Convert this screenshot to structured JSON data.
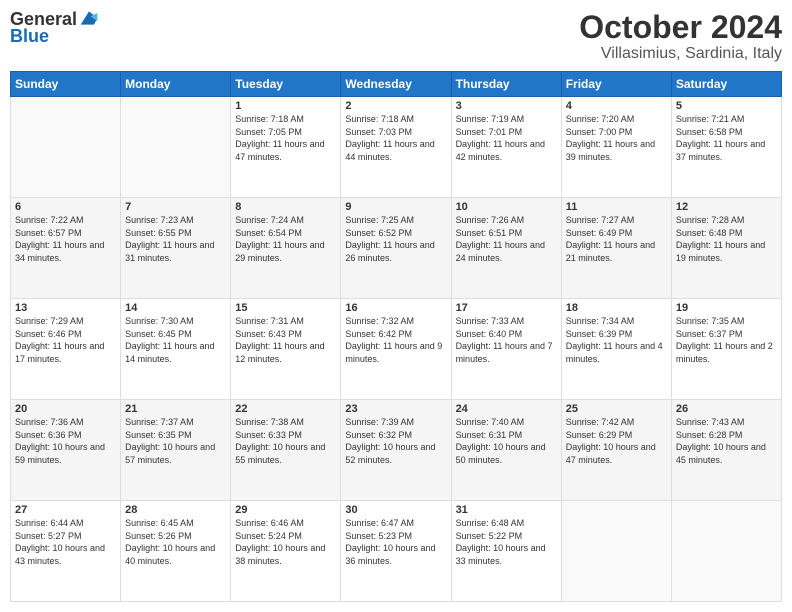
{
  "logo": {
    "line1": "General",
    "line2": "Blue"
  },
  "title": "October 2024",
  "subtitle": "Villasimius, Sardinia, Italy",
  "days_of_week": [
    "Sunday",
    "Monday",
    "Tuesday",
    "Wednesday",
    "Thursday",
    "Friday",
    "Saturday"
  ],
  "weeks": [
    [
      {
        "day": "",
        "info": ""
      },
      {
        "day": "",
        "info": ""
      },
      {
        "day": "1",
        "info": "Sunrise: 7:18 AM\nSunset: 7:05 PM\nDaylight: 11 hours and 47 minutes."
      },
      {
        "day": "2",
        "info": "Sunrise: 7:18 AM\nSunset: 7:03 PM\nDaylight: 11 hours and 44 minutes."
      },
      {
        "day": "3",
        "info": "Sunrise: 7:19 AM\nSunset: 7:01 PM\nDaylight: 11 hours and 42 minutes."
      },
      {
        "day": "4",
        "info": "Sunrise: 7:20 AM\nSunset: 7:00 PM\nDaylight: 11 hours and 39 minutes."
      },
      {
        "day": "5",
        "info": "Sunrise: 7:21 AM\nSunset: 6:58 PM\nDaylight: 11 hours and 37 minutes."
      }
    ],
    [
      {
        "day": "6",
        "info": "Sunrise: 7:22 AM\nSunset: 6:57 PM\nDaylight: 11 hours and 34 minutes."
      },
      {
        "day": "7",
        "info": "Sunrise: 7:23 AM\nSunset: 6:55 PM\nDaylight: 11 hours and 31 minutes."
      },
      {
        "day": "8",
        "info": "Sunrise: 7:24 AM\nSunset: 6:54 PM\nDaylight: 11 hours and 29 minutes."
      },
      {
        "day": "9",
        "info": "Sunrise: 7:25 AM\nSunset: 6:52 PM\nDaylight: 11 hours and 26 minutes."
      },
      {
        "day": "10",
        "info": "Sunrise: 7:26 AM\nSunset: 6:51 PM\nDaylight: 11 hours and 24 minutes."
      },
      {
        "day": "11",
        "info": "Sunrise: 7:27 AM\nSunset: 6:49 PM\nDaylight: 11 hours and 21 minutes."
      },
      {
        "day": "12",
        "info": "Sunrise: 7:28 AM\nSunset: 6:48 PM\nDaylight: 11 hours and 19 minutes."
      }
    ],
    [
      {
        "day": "13",
        "info": "Sunrise: 7:29 AM\nSunset: 6:46 PM\nDaylight: 11 hours and 17 minutes."
      },
      {
        "day": "14",
        "info": "Sunrise: 7:30 AM\nSunset: 6:45 PM\nDaylight: 11 hours and 14 minutes."
      },
      {
        "day": "15",
        "info": "Sunrise: 7:31 AM\nSunset: 6:43 PM\nDaylight: 11 hours and 12 minutes."
      },
      {
        "day": "16",
        "info": "Sunrise: 7:32 AM\nSunset: 6:42 PM\nDaylight: 11 hours and 9 minutes."
      },
      {
        "day": "17",
        "info": "Sunrise: 7:33 AM\nSunset: 6:40 PM\nDaylight: 11 hours and 7 minutes."
      },
      {
        "day": "18",
        "info": "Sunrise: 7:34 AM\nSunset: 6:39 PM\nDaylight: 11 hours and 4 minutes."
      },
      {
        "day": "19",
        "info": "Sunrise: 7:35 AM\nSunset: 6:37 PM\nDaylight: 11 hours and 2 minutes."
      }
    ],
    [
      {
        "day": "20",
        "info": "Sunrise: 7:36 AM\nSunset: 6:36 PM\nDaylight: 10 hours and 59 minutes."
      },
      {
        "day": "21",
        "info": "Sunrise: 7:37 AM\nSunset: 6:35 PM\nDaylight: 10 hours and 57 minutes."
      },
      {
        "day": "22",
        "info": "Sunrise: 7:38 AM\nSunset: 6:33 PM\nDaylight: 10 hours and 55 minutes."
      },
      {
        "day": "23",
        "info": "Sunrise: 7:39 AM\nSunset: 6:32 PM\nDaylight: 10 hours and 52 minutes."
      },
      {
        "day": "24",
        "info": "Sunrise: 7:40 AM\nSunset: 6:31 PM\nDaylight: 10 hours and 50 minutes."
      },
      {
        "day": "25",
        "info": "Sunrise: 7:42 AM\nSunset: 6:29 PM\nDaylight: 10 hours and 47 minutes."
      },
      {
        "day": "26",
        "info": "Sunrise: 7:43 AM\nSunset: 6:28 PM\nDaylight: 10 hours and 45 minutes."
      }
    ],
    [
      {
        "day": "27",
        "info": "Sunrise: 6:44 AM\nSunset: 5:27 PM\nDaylight: 10 hours and 43 minutes."
      },
      {
        "day": "28",
        "info": "Sunrise: 6:45 AM\nSunset: 5:26 PM\nDaylight: 10 hours and 40 minutes."
      },
      {
        "day": "29",
        "info": "Sunrise: 6:46 AM\nSunset: 5:24 PM\nDaylight: 10 hours and 38 minutes."
      },
      {
        "day": "30",
        "info": "Sunrise: 6:47 AM\nSunset: 5:23 PM\nDaylight: 10 hours and 36 minutes."
      },
      {
        "day": "31",
        "info": "Sunrise: 6:48 AM\nSunset: 5:22 PM\nDaylight: 10 hours and 33 minutes."
      },
      {
        "day": "",
        "info": ""
      },
      {
        "day": "",
        "info": ""
      }
    ]
  ]
}
